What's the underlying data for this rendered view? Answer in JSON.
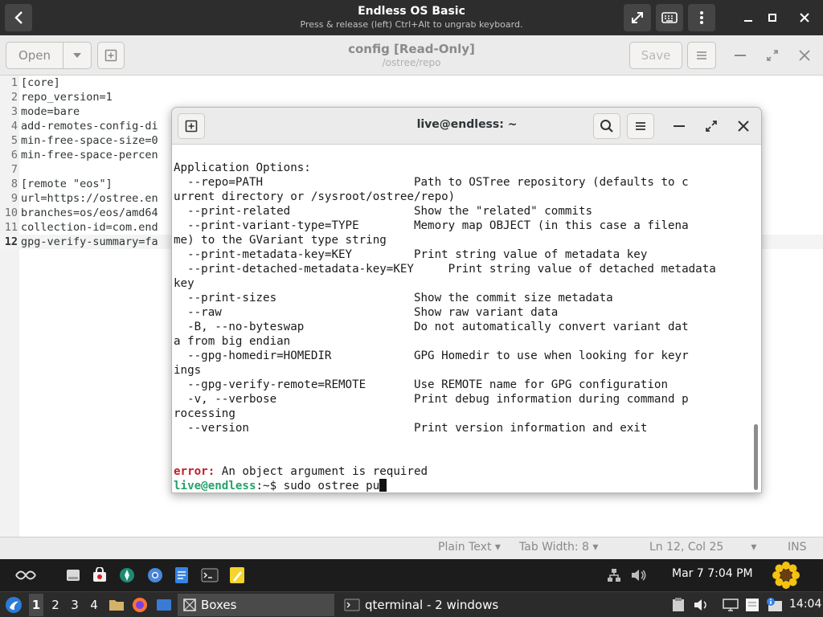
{
  "vm": {
    "title": "Endless OS Basic",
    "subtitle": "Press & release (left) Ctrl+Alt to ungrab keyboard."
  },
  "gedit": {
    "open_label": "Open",
    "save_label": "Save",
    "doc_title": "config [Read-Only]",
    "doc_path": "/ostree/repo",
    "lines": [
      {
        "n": "1",
        "text": "[core]"
      },
      {
        "n": "2",
        "text": "repo_version=1"
      },
      {
        "n": "3",
        "text": "mode=bare"
      },
      {
        "n": "4",
        "text": "add-remotes-config-di"
      },
      {
        "n": "5",
        "text": "min-free-space-size=0"
      },
      {
        "n": "6",
        "text": "min-free-space-percen"
      },
      {
        "n": "7",
        "text": ""
      },
      {
        "n": "8",
        "text": "[remote \"eos\"]"
      },
      {
        "n": "9",
        "text": "url=https://ostree.en"
      },
      {
        "n": "10",
        "text": "branches=os/eos/amd64"
      },
      {
        "n": "11",
        "text": "collection-id=com.end"
      },
      {
        "n": "12",
        "text": "gpg-verify-summary=fa"
      }
    ],
    "status": {
      "language": "Plain Text",
      "tab_width": "Tab Width: 8",
      "position": "Ln 12, Col 25",
      "mode": "INS"
    }
  },
  "terminal": {
    "title": "live@endless: ~",
    "lines": [
      "Application Options:",
      "  --repo=PATH                      Path to OSTree repository (defaults to c",
      "urrent directory or /sysroot/ostree/repo)",
      "  --print-related                  Show the \"related\" commits",
      "  --print-variant-type=TYPE        Memory map OBJECT (in this case a filena",
      "me) to the GVariant type string",
      "  --print-metadata-key=KEY         Print string value of metadata key",
      "  --print-detached-metadata-key=KEY     Print string value of detached metadata",
      "key",
      "  --print-sizes                    Show the commit size metadata",
      "  --raw                            Show raw variant data",
      "  -B, --no-byteswap                Do not automatically convert variant dat",
      "a from big endian",
      "  --gpg-homedir=HOMEDIR            GPG Homedir to use when looking for keyr",
      "ings",
      "  --gpg-verify-remote=REMOTE       Use REMOTE name for GPG configuration",
      "  -v, --verbose                    Print debug information during command p",
      "rocessing",
      "  --version                        Print version information and exit",
      ""
    ],
    "error_label": "error:",
    "error_msg": " An object argument is required",
    "prompt_user": "live@endless",
    "prompt_rest": ":~$ sudo ostree pu"
  },
  "panel_top": {
    "clock": "Mar 7  7:04 PM"
  },
  "panel_bottom": {
    "workspaces": [
      "1",
      "2",
      "3",
      "4"
    ],
    "task1": "Boxes",
    "task2": "qterminal - 2 windows",
    "clock": "14:04"
  }
}
